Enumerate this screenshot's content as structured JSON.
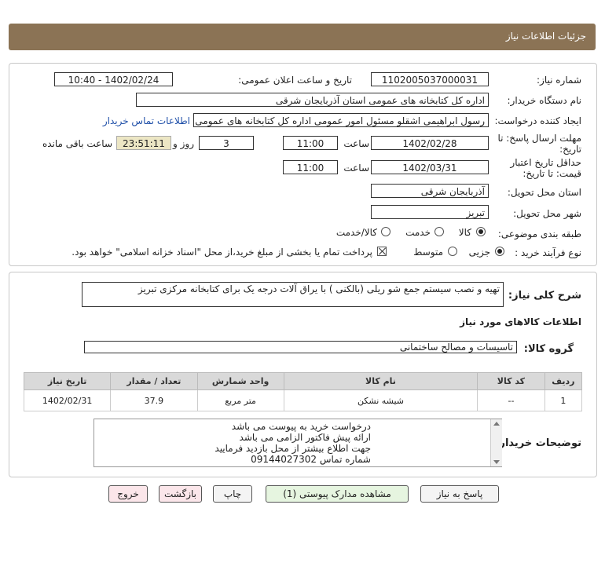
{
  "header": {
    "title": "جزئیات اطلاعات نیاز"
  },
  "fields": {
    "need_number_label": "شماره نیاز:",
    "need_number": "1102005037000031",
    "announce_label": "تاریخ و ساعت اعلان عمومی:",
    "announce_value": "1402/02/24 - 10:40",
    "buyer_org_label": "نام دستگاه خریدار:",
    "buyer_org": "اداره کل کتابخانه های عمومی استان آذربایجان شرقی",
    "requester_label": "ایجاد کننده درخواست:",
    "requester": "رسول ابراهیمی اشقلو مسئول امور عمومی اداره کل کتابخانه های عمومی استان",
    "contact_link": "اطلاعات تماس خریدار",
    "deadline_label_1": "مهلت ارسال پاسخ: تا",
    "deadline_label_2": "تاریخ:",
    "deadline_date": "1402/02/28",
    "time_label": "ساعت",
    "deadline_time": "11:00",
    "days_value": "3",
    "days_label": "روز و",
    "remaining_value": "23:51:11",
    "remaining_label": "ساعت باقی مانده",
    "validity_label_1": "حداقل تاریخ اعتبار",
    "validity_label_2": "قیمت: تا تاریخ:",
    "validity_date": "1402/03/31",
    "validity_time": "11:00",
    "province_label": "استان محل تحویل:",
    "province": "آذربایجان شرقی",
    "city_label": "شهر محل تحویل:",
    "city": "تبریز",
    "category_label": "طبقه بندی موضوعی:",
    "category_options": [
      "کالا",
      "خدمت",
      "کالا/خدمت"
    ],
    "process_label": "نوع فرآیند خرید :",
    "process_options": [
      "جزیی",
      "متوسط"
    ],
    "payment_note": "پرداخت تمام یا بخشی از مبلغ خرید،از محل \"اسناد خزانه اسلامی\" خواهد بود."
  },
  "summary": {
    "label": "شرح کلی نیاز:",
    "value": "تهیه و نصب سیستم جمع شو ریلی (بالکنی ) با یراق آلات درجه یک برای کتابخانه مرکزی تبریز"
  },
  "goods": {
    "section_title": "اطلاعات کالاهای مورد نیاز",
    "group_label": "گروه کالا:",
    "group_value": "تاسیسات و مصالح ساختمانی",
    "columns": [
      "ردیف",
      "کد کالا",
      "نام کالا",
      "واحد شمارش",
      "تعداد / مقدار",
      "تاریخ نیاز"
    ],
    "rows": [
      {
        "row": "1",
        "code": "--",
        "name": "شیشه نشکن",
        "unit": "متر مربع",
        "qty": "37.9",
        "date": "1402/02/31"
      }
    ]
  },
  "buyer_notes": {
    "label": "توضیحات خریدار:",
    "lines": [
      "درخواست خرید به پیوست می باشد",
      "ارائه پیش فاکتور الزامی می باشد",
      "جهت اطلاع بیشتر از محل بازدید فرمایید",
      "شماره تماس 09144027302"
    ]
  },
  "buttons": {
    "reply": "پاسخ به نیاز",
    "attachments": "مشاهده مدارک پیوستی (1)",
    "print": "چاپ",
    "back": "بازگشت",
    "exit": "خروج"
  },
  "colors": {
    "header": "#8b7355",
    "remaining_bg": "#ece6c4"
  }
}
